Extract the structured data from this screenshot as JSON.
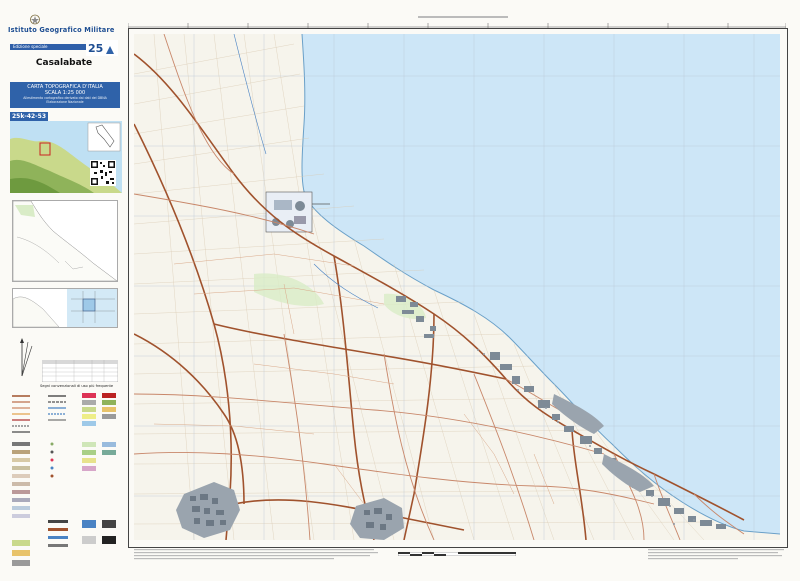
{
  "header": {
    "institute": "Istituto Geografico Militare",
    "edition": "Edizione speciale",
    "sheet_name": "Casalabate"
  },
  "info_box": {
    "line1": "CARTA TOPOGRAFICA D'ITALIA",
    "line2": "SCALA 1:25 000",
    "line3": "Allestimento cartografico derivato dai dati del DBNA",
    "line4": "Elaborazione Nazionale"
  },
  "sheet_code": "25k-42-53",
  "legend": {
    "heading": "Segni convenzionali di uso più frequente"
  },
  "colors": {
    "sea": "#cde6f7",
    "land": "#f6f4ec",
    "road_primary": "#a0522d",
    "road_secondary": "#c8876a",
    "igm_blue": "#2f62a9",
    "urban": "#7d8a96"
  }
}
